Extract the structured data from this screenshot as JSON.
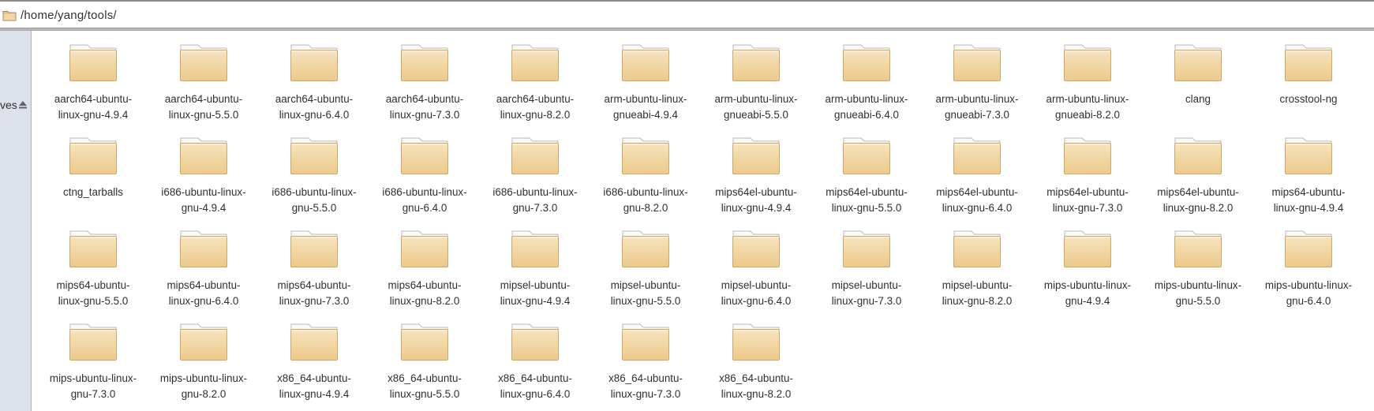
{
  "location": {
    "icon": "folder-icon",
    "path": "/home/yang/tools/"
  },
  "sidebar": {
    "drive_label": "ves",
    "eject_icon": "eject-icon"
  },
  "items": [
    {
      "line1": "aarch64-ubuntu-",
      "line2": "linux-gnu-4.9.4"
    },
    {
      "line1": "aarch64-ubuntu-",
      "line2": "linux-gnu-5.5.0"
    },
    {
      "line1": "aarch64-ubuntu-",
      "line2": "linux-gnu-6.4.0"
    },
    {
      "line1": "aarch64-ubuntu-",
      "line2": "linux-gnu-7.3.0"
    },
    {
      "line1": "aarch64-ubuntu-",
      "line2": "linux-gnu-8.2.0"
    },
    {
      "line1": "arm-ubuntu-linux-",
      "line2": "gnueabi-4.9.4"
    },
    {
      "line1": "arm-ubuntu-linux-",
      "line2": "gnueabi-5.5.0"
    },
    {
      "line1": "arm-ubuntu-linux-",
      "line2": "gnueabi-6.4.0"
    },
    {
      "line1": "arm-ubuntu-linux-",
      "line2": "gnueabi-7.3.0"
    },
    {
      "line1": "arm-ubuntu-linux-",
      "line2": "gnueabi-8.2.0"
    },
    {
      "line1": "clang",
      "line2": ""
    },
    {
      "line1": "crosstool-ng",
      "line2": ""
    },
    {
      "line1": "ctng_tarballs",
      "line2": ""
    },
    {
      "line1": "i686-ubuntu-linux-",
      "line2": "gnu-4.9.4"
    },
    {
      "line1": "i686-ubuntu-linux-",
      "line2": "gnu-5.5.0"
    },
    {
      "line1": "i686-ubuntu-linux-",
      "line2": "gnu-6.4.0"
    },
    {
      "line1": "i686-ubuntu-linux-",
      "line2": "gnu-7.3.0"
    },
    {
      "line1": "i686-ubuntu-linux-",
      "line2": "gnu-8.2.0"
    },
    {
      "line1": "mips64el-ubuntu-",
      "line2": "linux-gnu-4.9.4"
    },
    {
      "line1": "mips64el-ubuntu-",
      "line2": "linux-gnu-5.5.0"
    },
    {
      "line1": "mips64el-ubuntu-",
      "line2": "linux-gnu-6.4.0"
    },
    {
      "line1": "mips64el-ubuntu-",
      "line2": "linux-gnu-7.3.0"
    },
    {
      "line1": "mips64el-ubuntu-",
      "line2": "linux-gnu-8.2.0"
    },
    {
      "line1": "mips64-ubuntu-",
      "line2": "linux-gnu-4.9.4"
    },
    {
      "line1": "mips64-ubuntu-",
      "line2": "linux-gnu-5.5.0"
    },
    {
      "line1": "mips64-ubuntu-",
      "line2": "linux-gnu-6.4.0"
    },
    {
      "line1": "mips64-ubuntu-",
      "line2": "linux-gnu-7.3.0"
    },
    {
      "line1": "mips64-ubuntu-",
      "line2": "linux-gnu-8.2.0"
    },
    {
      "line1": "mipsel-ubuntu-",
      "line2": "linux-gnu-4.9.4"
    },
    {
      "line1": "mipsel-ubuntu-",
      "line2": "linux-gnu-5.5.0"
    },
    {
      "line1": "mipsel-ubuntu-",
      "line2": "linux-gnu-6.4.0"
    },
    {
      "line1": "mipsel-ubuntu-",
      "line2": "linux-gnu-7.3.0"
    },
    {
      "line1": "mipsel-ubuntu-",
      "line2": "linux-gnu-8.2.0"
    },
    {
      "line1": "mips-ubuntu-linux-",
      "line2": "gnu-4.9.4"
    },
    {
      "line1": "mips-ubuntu-linux-",
      "line2": "gnu-5.5.0"
    },
    {
      "line1": "mips-ubuntu-linux-",
      "line2": "gnu-6.4.0"
    },
    {
      "line1": "mips-ubuntu-linux-",
      "line2": "gnu-7.3.0"
    },
    {
      "line1": "mips-ubuntu-linux-",
      "line2": "gnu-8.2.0"
    },
    {
      "line1": "x86_64-ubuntu-",
      "line2": "linux-gnu-4.9.4"
    },
    {
      "line1": "x86_64-ubuntu-",
      "line2": "linux-gnu-5.5.0"
    },
    {
      "line1": "x86_64-ubuntu-",
      "line2": "linux-gnu-6.4.0"
    },
    {
      "line1": "x86_64-ubuntu-",
      "line2": "linux-gnu-7.3.0"
    },
    {
      "line1": "x86_64-ubuntu-",
      "line2": "linux-gnu-8.2.0"
    }
  ],
  "item_icon": "folder-icon",
  "colors": {
    "folder_body": "#f1d8a9",
    "folder_tab": "#f7f7f7",
    "sidebar_bg": "#dde2ea"
  }
}
